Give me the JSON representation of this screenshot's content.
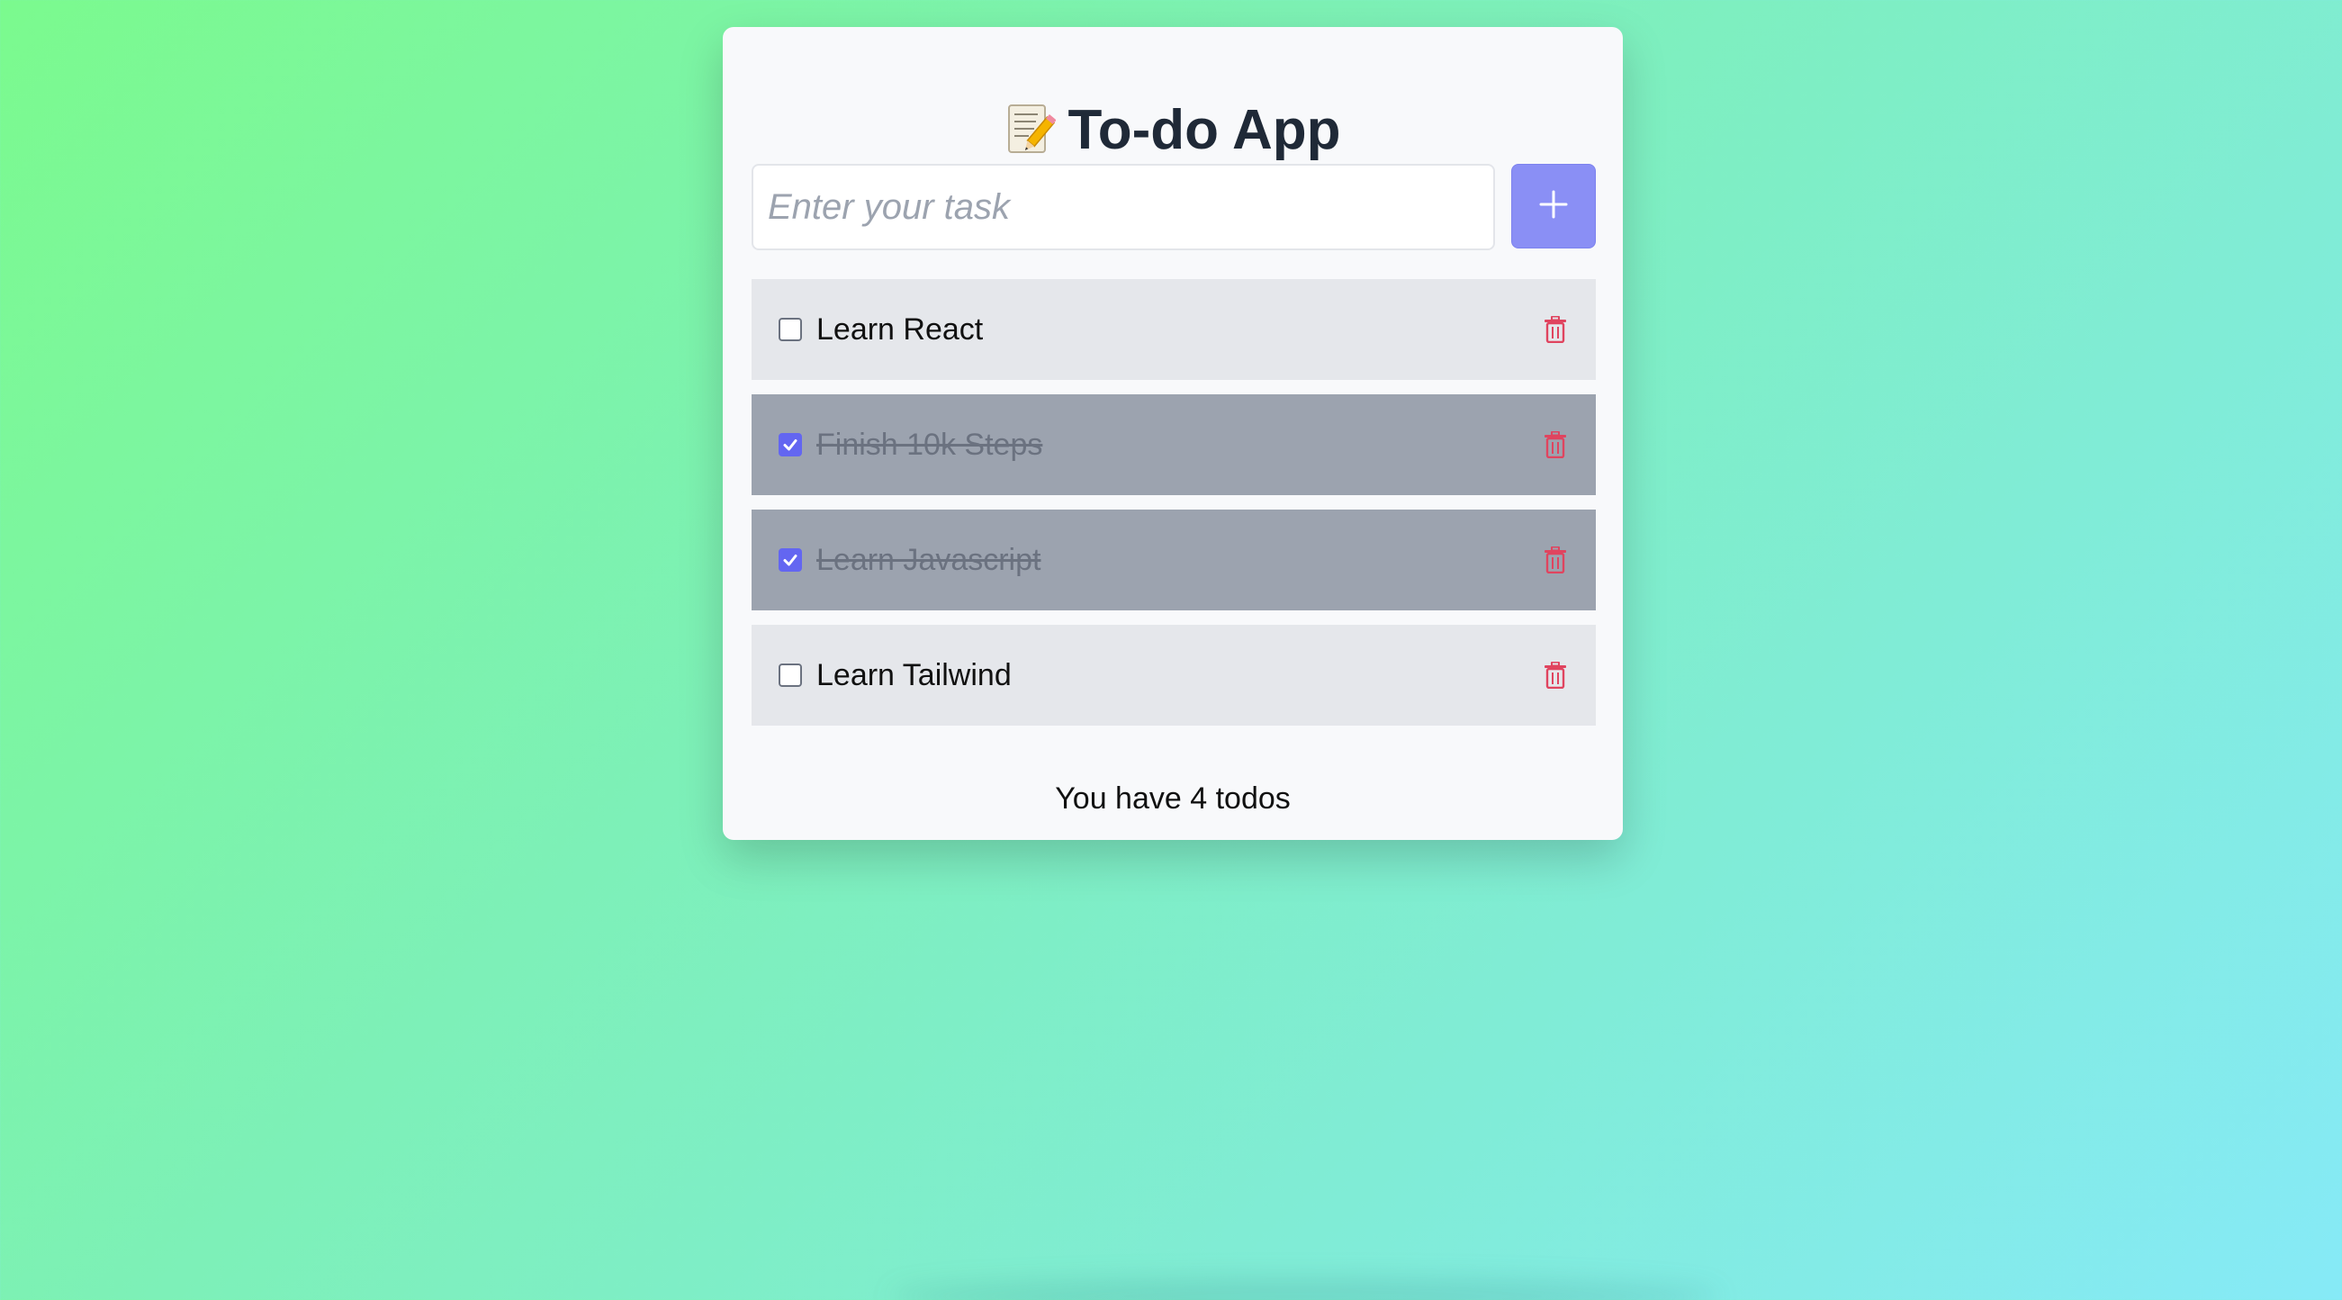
{
  "app": {
    "title": "To-do App",
    "title_icon": "memo-icon"
  },
  "input": {
    "placeholder": "Enter your task",
    "value": ""
  },
  "add_button": {
    "icon": "plus-icon",
    "color": "#8a8ff5"
  },
  "todos": [
    {
      "text": "Learn React",
      "completed": false
    },
    {
      "text": "Finish 10k Steps",
      "completed": true
    },
    {
      "text": "Learn Javascript",
      "completed": true
    },
    {
      "text": "Learn Tailwind",
      "completed": false
    }
  ],
  "footer": {
    "count_text": "You have 4 todos"
  },
  "colors": {
    "accent": "#6366f1",
    "delete": "#e0445f",
    "completed_row": "#9ca3af",
    "pending_row": "#e5e7eb"
  }
}
